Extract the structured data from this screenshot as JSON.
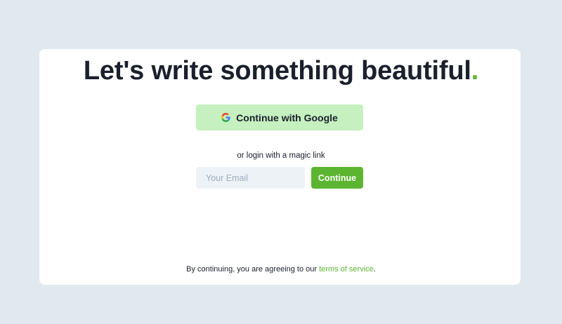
{
  "headline": {
    "text": "Let's write something beautiful",
    "accent": "."
  },
  "google_button": {
    "label": "Continue with Google",
    "icon": "google-g-icon"
  },
  "magic_link": {
    "prompt": "or login with a magic link",
    "email_placeholder": "Your Email",
    "email_value": "",
    "continue_label": "Continue"
  },
  "terms": {
    "prefix": "By continuing, you are agreeing to our ",
    "link_text": "terms of service",
    "suffix": "."
  },
  "colors": {
    "background": "#e2e8f0",
    "card": "#ffffff",
    "accent": "#5cb531",
    "google_button_bg": "#c6f0c0",
    "input_bg": "#edf2f7",
    "text": "#1a202c"
  }
}
